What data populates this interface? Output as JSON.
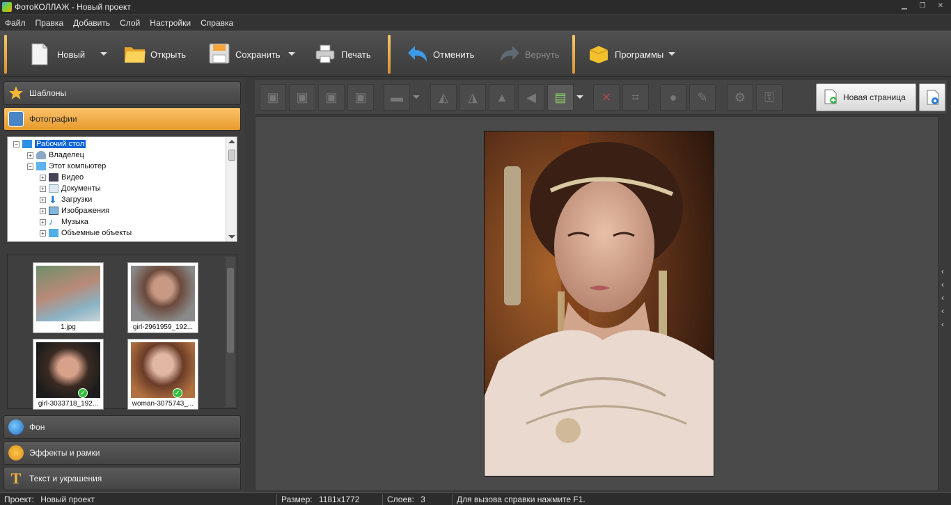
{
  "window": {
    "title": "ФотоКОЛЛАЖ - Новый проект",
    "minimize": "▁",
    "restore": "❐",
    "close": "✕"
  },
  "menu": [
    "Файл",
    "Правка",
    "Добавить",
    "Слой",
    "Настройки",
    "Справка"
  ],
  "toolbar": {
    "new_label": "Новый",
    "open_label": "Открыть",
    "save_label": "Сохранить",
    "print_label": "Печать",
    "undo_label": "Отменить",
    "redo_label": "Вернуть",
    "programs_label": "Программы"
  },
  "sidebar": {
    "templates_label": "Шаблоны",
    "photos_label": "Фотографии",
    "background_label": "Фон",
    "effects_label": "Эффекты и рамки",
    "text_label": "Текст и украшения"
  },
  "tree": {
    "items": [
      {
        "label": "Рабочий стол",
        "selected": true
      },
      {
        "label": "Владелец"
      },
      {
        "label": "Этот компьютер"
      },
      {
        "label": "Видео"
      },
      {
        "label": "Документы"
      },
      {
        "label": "Загрузки"
      },
      {
        "label": "Изображения"
      },
      {
        "label": "Музыка"
      },
      {
        "label": "Объемные объекты"
      }
    ]
  },
  "thumbnails": [
    {
      "name": "1.jpg",
      "used": false
    },
    {
      "name": "girl-2961959_192...",
      "used": false
    },
    {
      "name": "girl-3033718_192...",
      "used": true
    },
    {
      "name": "woman-3075743_...",
      "used": true
    }
  ],
  "edit_toolbar": {
    "new_page_label": "Новая страница"
  },
  "statusbar": {
    "project_label": "Проект:",
    "project_value": "Новый проект",
    "size_label": "Размер:",
    "size_value": "1181x1772",
    "layers_label": "Слоев:",
    "layers_value": "3",
    "help_text": "Для вызова справки нажмите F1."
  },
  "colors": {
    "accent": "#f0a63a",
    "selection": "#0a64d8"
  }
}
